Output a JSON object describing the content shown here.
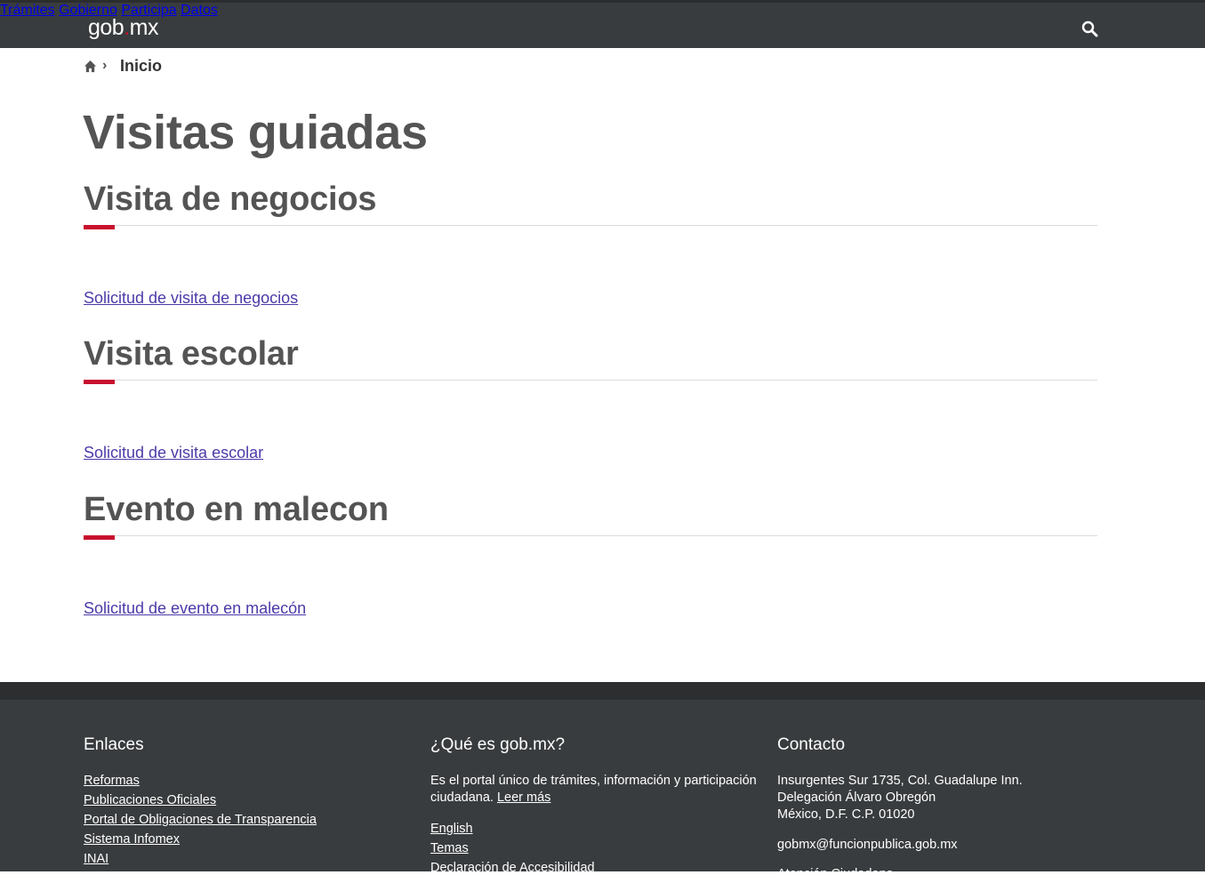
{
  "header": {
    "logo_left": "gob",
    "logo_dot": ".",
    "logo_right": "mx",
    "nav": [
      "Trámites",
      "Gobierno",
      "Participa",
      "Datos"
    ]
  },
  "breadcrumb": {
    "current": "Inicio",
    "separator": "›"
  },
  "page_title": "Visitas guiadas",
  "sections": [
    {
      "title": "Visita de negocios",
      "link": "Solicitud de visita de negocios"
    },
    {
      "title": "Visita escolar",
      "link": "Solicitud de visita escolar"
    },
    {
      "title": "Evento en malecon",
      "link": "Solicitud de evento en malecón"
    }
  ],
  "footer": {
    "enlaces": {
      "title": "Enlaces",
      "items": [
        "Reformas",
        "Publicaciones Oficiales",
        "Portal de Obligaciones de Transparencia",
        "Sistema Infomex",
        "INAI"
      ]
    },
    "que_es": {
      "title": "¿Qué es gob.mx?",
      "text": "Es el portal único de trámites, información y participación ciudadana.",
      "read_more": "Leer más",
      "links": [
        "English",
        "Temas",
        "Declaración de Accesibilidad"
      ]
    },
    "contacto": {
      "title": "Contacto",
      "address_1": "Insurgentes Sur 1735, Col. Guadalupe Inn.",
      "address_2": "Delegación Álvaro Obregón",
      "address_3": "México, D.F. C.P. 01020",
      "email": "gobmx@funcionpublica.gob.mx",
      "extra": "Atención Ciudadana"
    }
  },
  "colors": {
    "header_bg": "#393c3e",
    "accent": "#c8102e",
    "link": "#4d3aa8",
    "text": "#545454"
  }
}
